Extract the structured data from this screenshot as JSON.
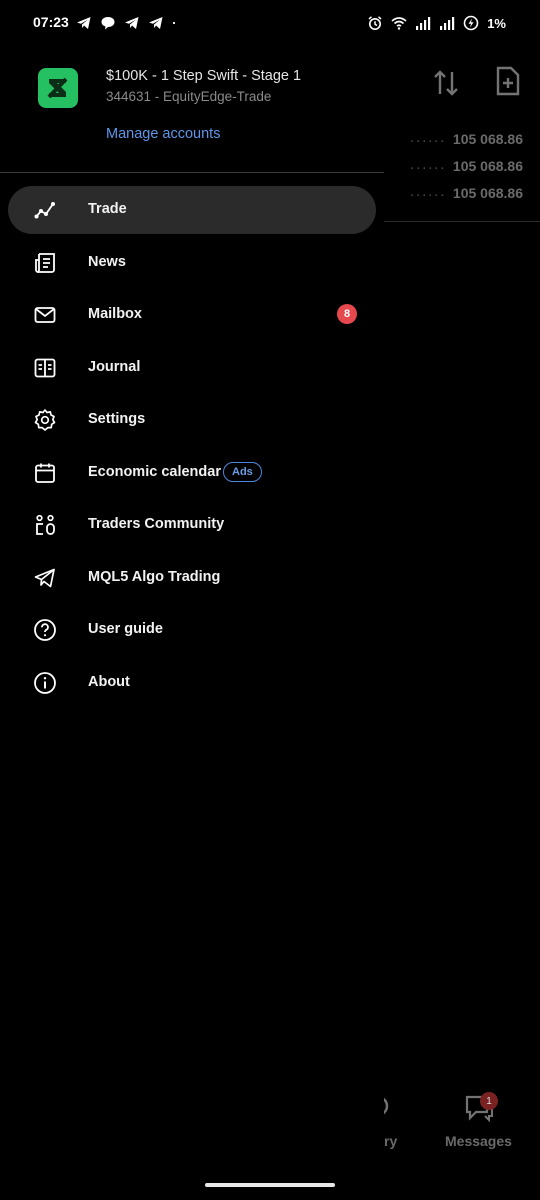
{
  "status_bar": {
    "time": "07:23",
    "battery_text": "1%",
    "icons_left": [
      "telegram-icon",
      "chat-bubble-icon",
      "telegram-icon",
      "telegram-icon",
      "dot-icon"
    ],
    "icons_right": [
      "alarm-icon",
      "wifi-icon",
      "signal-icon",
      "signal-icon",
      "battery-charging-icon"
    ]
  },
  "account": {
    "name": "$100K - 1 Step Swift - Stage 1",
    "subtitle": "344631 - EquityEdge-Trade",
    "manage_link": "Manage accounts",
    "logo_color": "#25c061"
  },
  "menu": {
    "items": [
      {
        "label": "Trade",
        "icon": "trade-chart-icon",
        "active": true
      },
      {
        "label": "News",
        "icon": "news-icon"
      },
      {
        "label": "Mailbox",
        "icon": "mail-icon",
        "badge": "8"
      },
      {
        "label": "Journal",
        "icon": "journal-icon"
      },
      {
        "label": "Settings",
        "icon": "gear-icon"
      },
      {
        "label": "Economic calendar",
        "icon": "calendar-icon",
        "tag": "Ads"
      },
      {
        "label": "Traders Community",
        "icon": "community-icon"
      },
      {
        "label": "MQL5 Algo Trading",
        "icon": "send-icon"
      },
      {
        "label": "User guide",
        "icon": "help-icon"
      },
      {
        "label": "About",
        "icon": "info-icon"
      }
    ]
  },
  "background": {
    "values": [
      "105 068.86",
      "105 068.86",
      "105 068.86"
    ],
    "nav_partial_label": "ry",
    "nav_messages_label": "Messages",
    "messages_badge": "1"
  },
  "colors": {
    "accent": "#5f96e8",
    "badge": "#e5484d",
    "active_bg": "#2b2b2b"
  }
}
